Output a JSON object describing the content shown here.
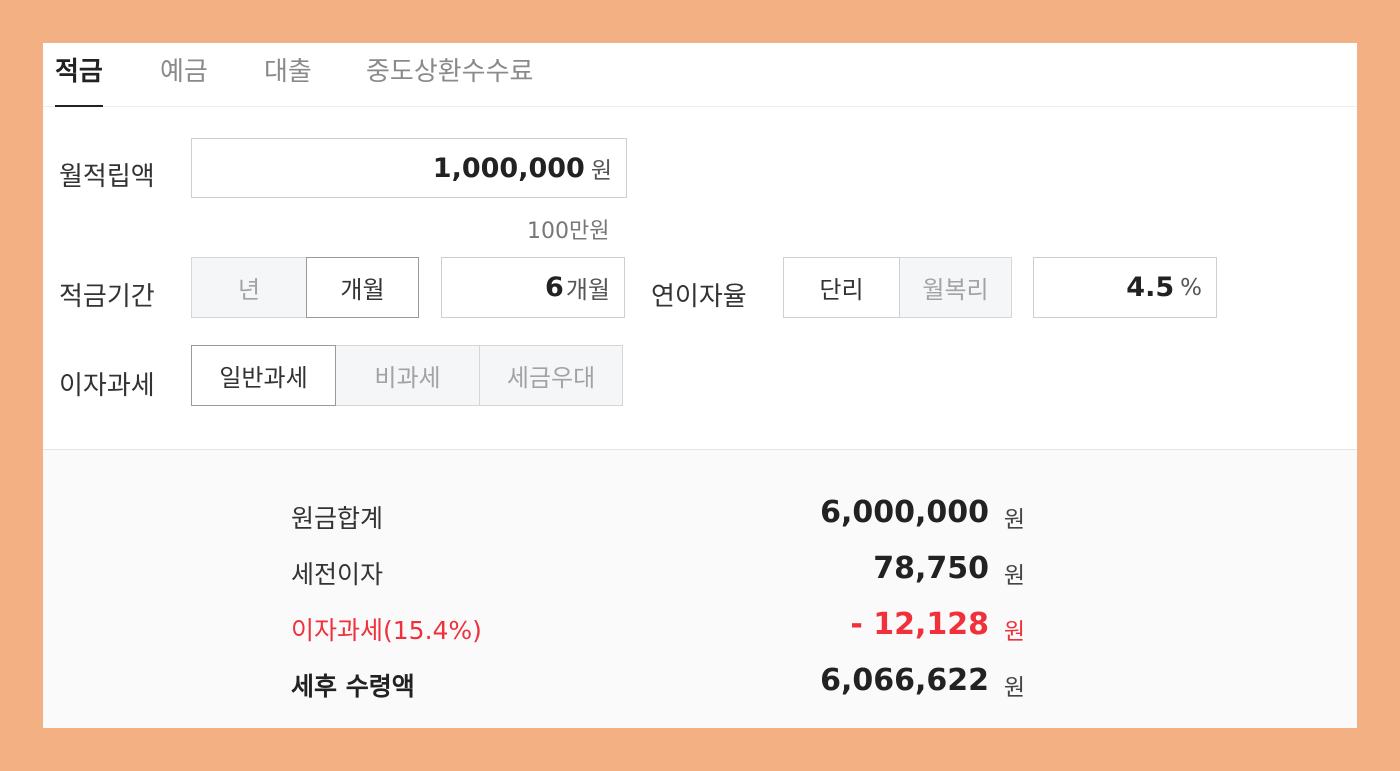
{
  "tabs": [
    {
      "label": "적금",
      "active": true
    },
    {
      "label": "예금",
      "active": false
    },
    {
      "label": "대출",
      "active": false
    },
    {
      "label": "중도상환수수료",
      "active": false
    }
  ],
  "form": {
    "monthly_deposit": {
      "label": "월적립액",
      "value": "1,000,000",
      "unit": "원",
      "hint": "100만원"
    },
    "period": {
      "label": "적금기간",
      "unit_options": [
        {
          "label": "년",
          "selected": false
        },
        {
          "label": "개월",
          "selected": true
        }
      ],
      "value": "6",
      "unit": "개월"
    },
    "rate": {
      "label": "연이자율",
      "type_options": [
        {
          "label": "단리",
          "selected": true
        },
        {
          "label": "월복리",
          "selected": false
        }
      ],
      "value": "4.5",
      "unit": "%"
    },
    "tax": {
      "label": "이자과세",
      "options": [
        {
          "label": "일반과세",
          "selected": true
        },
        {
          "label": "비과세",
          "selected": false
        },
        {
          "label": "세금우대",
          "selected": false
        }
      ]
    }
  },
  "results": [
    {
      "label": "원금합계",
      "value": "6,000,000",
      "unit": "원",
      "style": "normal"
    },
    {
      "label": "세전이자",
      "value": "78,750",
      "unit": "원",
      "style": "normal"
    },
    {
      "label": "이자과세(15.4%)",
      "value": "- 12,128",
      "unit": "원",
      "style": "red"
    },
    {
      "label": "세후 수령액",
      "value": "6,066,622",
      "unit": "원",
      "style": "bold"
    }
  ],
  "colors": {
    "frame": "#f2b083",
    "tax_red": "#f0303a",
    "panel": "#ffffff"
  }
}
